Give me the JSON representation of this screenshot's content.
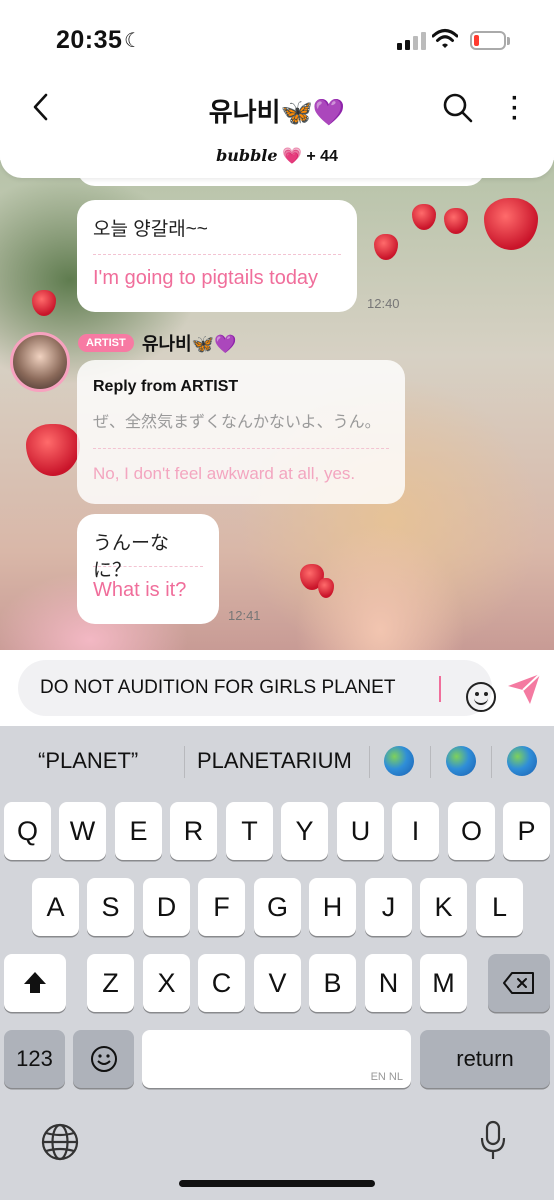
{
  "status_bar": {
    "time": "20:35",
    "moon": "☾"
  },
  "header": {
    "title": "유나비🦋💜",
    "subtitle_brand": "bubble",
    "subtitle_heart": "💗",
    "subtitle_count": "+ 44"
  },
  "messages": [
    {
      "original": "오늘 양갈래~~",
      "translation": "I'm going to pigtails today",
      "time": "12:40"
    },
    {
      "original": "うんーなに？",
      "translation": "What is it?",
      "time": "12:41"
    }
  ],
  "artist": {
    "badge": "ARTIST",
    "name": "유나비🦋💜"
  },
  "reply": {
    "header": "Reply from ARTIST",
    "original": "ぜ、全然気まずくなんかないよ、うん。",
    "translation": "No, I don't feel awkward at all, yes."
  },
  "input": {
    "value": "DO NOT AUDITION FOR GIRLS PLANET"
  },
  "suggestions": [
    "“PLANET”",
    "PLANETARIUM"
  ],
  "keyboard": {
    "row1": [
      "Q",
      "W",
      "E",
      "R",
      "T",
      "Y",
      "U",
      "I",
      "O",
      "P"
    ],
    "row2": [
      "A",
      "S",
      "D",
      "F",
      "G",
      "H",
      "J",
      "K",
      "L"
    ],
    "row3": [
      "Z",
      "X",
      "C",
      "V",
      "B",
      "N",
      "M"
    ],
    "numbers": "123",
    "space_hint": "EN NL",
    "return": "return"
  },
  "colors": {
    "accent": "#f06e9b",
    "badge": "#f77aa3",
    "keyboard_bg": "#d3d5da"
  },
  "icons": [
    "back-chevron-icon",
    "search-icon",
    "more-vertical-icon",
    "emoji-icon",
    "send-icon",
    "shift-icon",
    "backspace-icon",
    "emoji-keyboard-icon",
    "globe-icon",
    "microphone-icon"
  ]
}
